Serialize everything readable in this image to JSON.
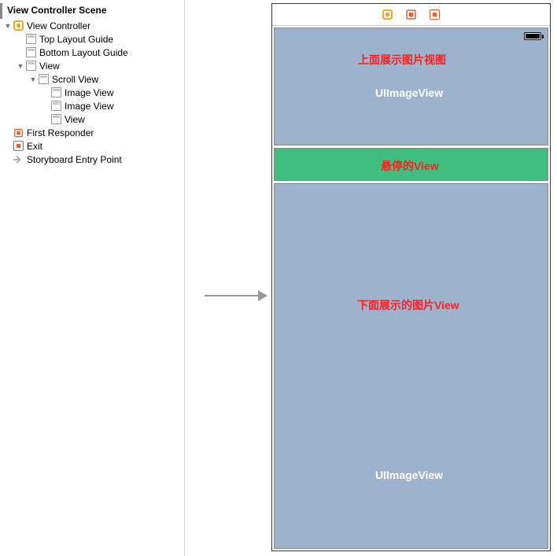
{
  "outline": {
    "scene_title": "View Controller Scene",
    "items": [
      {
        "label": "View Controller",
        "icon": "vc",
        "indent": 0,
        "disclosure": "▼"
      },
      {
        "label": "Top Layout Guide",
        "icon": "rect",
        "indent": 1,
        "disclosure": ""
      },
      {
        "label": "Bottom Layout Guide",
        "icon": "rect",
        "indent": 1,
        "disclosure": ""
      },
      {
        "label": "View",
        "icon": "rect",
        "indent": 1,
        "disclosure": "▼"
      },
      {
        "label": "Scroll View",
        "icon": "rect",
        "indent": 2,
        "disclosure": "▼"
      },
      {
        "label": "Image View",
        "icon": "rect",
        "indent": 3,
        "disclosure": ""
      },
      {
        "label": "Image View",
        "icon": "rect",
        "indent": 3,
        "disclosure": ""
      },
      {
        "label": "View",
        "icon": "rect",
        "indent": 3,
        "disclosure": ""
      },
      {
        "label": "First Responder",
        "icon": "fr",
        "indent": 0,
        "disclosure": ""
      },
      {
        "label": "Exit",
        "icon": "exit",
        "indent": 0,
        "disclosure": ""
      },
      {
        "label": "Storyboard Entry Point",
        "icon": "arrow",
        "indent": 0,
        "disclosure": ""
      }
    ]
  },
  "device": {
    "annotations": {
      "upper_title": "上面展示图片视图",
      "upper_class": "UIImageView",
      "hover_title": "悬停的View",
      "lower_title": "下面展示的图片View",
      "lower_class": "UIImageView"
    }
  }
}
